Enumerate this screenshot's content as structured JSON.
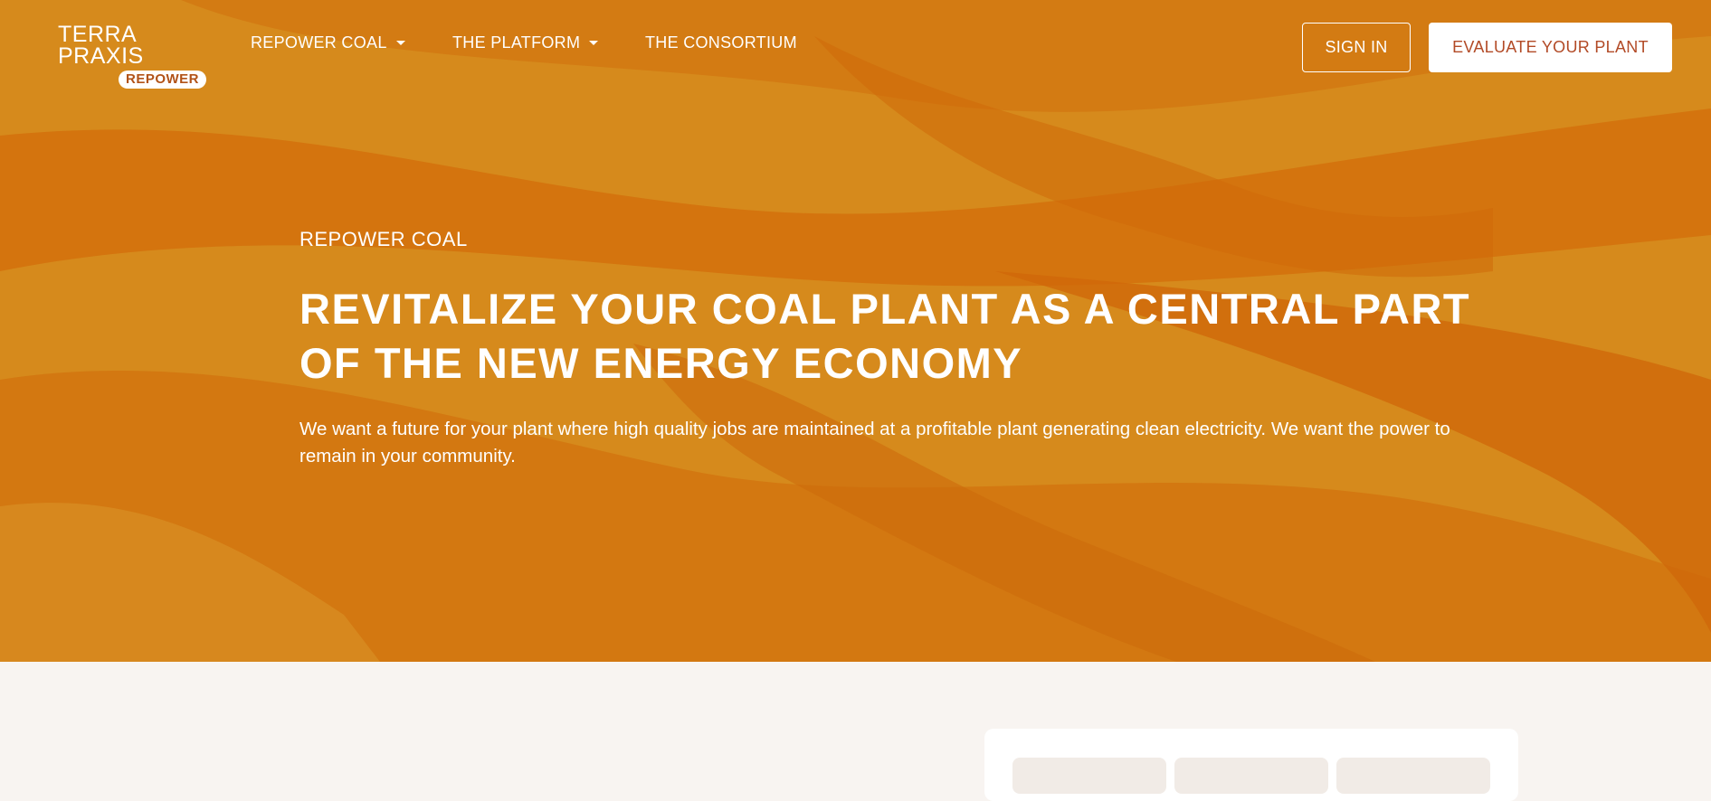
{
  "logo": {
    "line1": "TERRA",
    "line2": "PRAXIS",
    "badge": "REPOWER"
  },
  "nav": {
    "items": [
      {
        "label": "REPOWER COAL",
        "dropdown": true
      },
      {
        "label": "THE PLATFORM",
        "dropdown": true
      },
      {
        "label": "THE CONSORTIUM",
        "dropdown": false
      }
    ],
    "sign_in": "SIGN IN",
    "cta": "EVALUATE YOUR PLANT"
  },
  "hero": {
    "eyebrow": "REPOWER COAL",
    "headline": "REVITALIZE YOUR COAL PLANT AS A CENTRAL PART OF THE NEW ENERGY ECONOMY",
    "body": "We want a future for your plant where high quality jobs are maintained at a profitable plant generating clean electricity. We want the power to remain in your community."
  },
  "colors": {
    "hero_orange": "#d2780f",
    "hero_dark": "#d4650a",
    "page_bg": "#f8f4f1",
    "cta_text": "#b24a26"
  }
}
